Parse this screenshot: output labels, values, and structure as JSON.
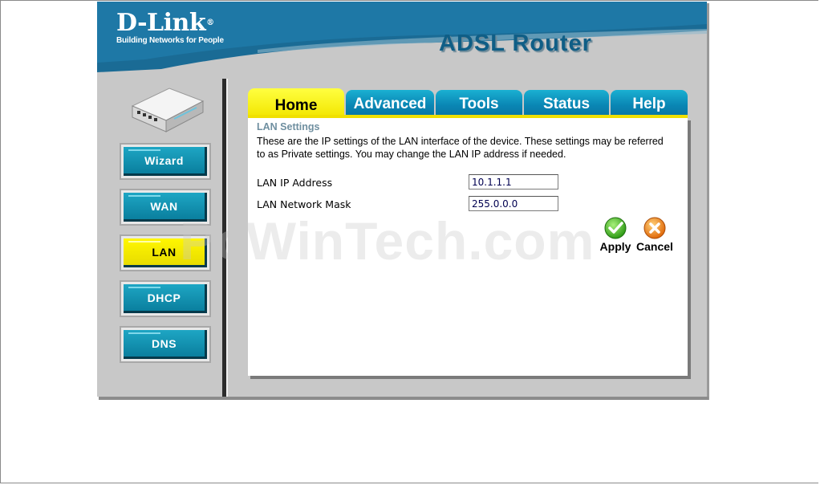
{
  "brand": {
    "logo_text": "D-Link",
    "logo_reg": "®",
    "tagline": "Building Networks for People",
    "product_title": "ADSL Router"
  },
  "sidebar": {
    "buttons": [
      {
        "label": "Wizard",
        "active": false
      },
      {
        "label": "WAN",
        "active": false
      },
      {
        "label": "LAN",
        "active": true
      },
      {
        "label": "DHCP",
        "active": false
      },
      {
        "label": "DNS",
        "active": false
      }
    ]
  },
  "tabs": [
    {
      "label": "Home",
      "active": true
    },
    {
      "label": "Advanced",
      "active": false
    },
    {
      "label": "Tools",
      "active": false
    },
    {
      "label": "Status",
      "active": false
    },
    {
      "label": "Help",
      "active": false
    }
  ],
  "main": {
    "section_title": "LAN Settings",
    "description": "These are the IP settings of the LAN interface of the device. These settings may be referred to as Private settings. You may change the LAN IP address if needed.",
    "fields": [
      {
        "label": "LAN IP Address",
        "value": "10.1.1.1"
      },
      {
        "label": "LAN Network Mask",
        "value": "255.0.0.0"
      }
    ],
    "apply_label": "Apply",
    "cancel_label": "Cancel"
  },
  "watermark": "PcWinTech.com",
  "colors": {
    "header_blue": "#0f5e86",
    "tab_blue": "#0a86b4",
    "active_yellow": "#f2e600",
    "frame_gray": "#c8c8c8"
  }
}
